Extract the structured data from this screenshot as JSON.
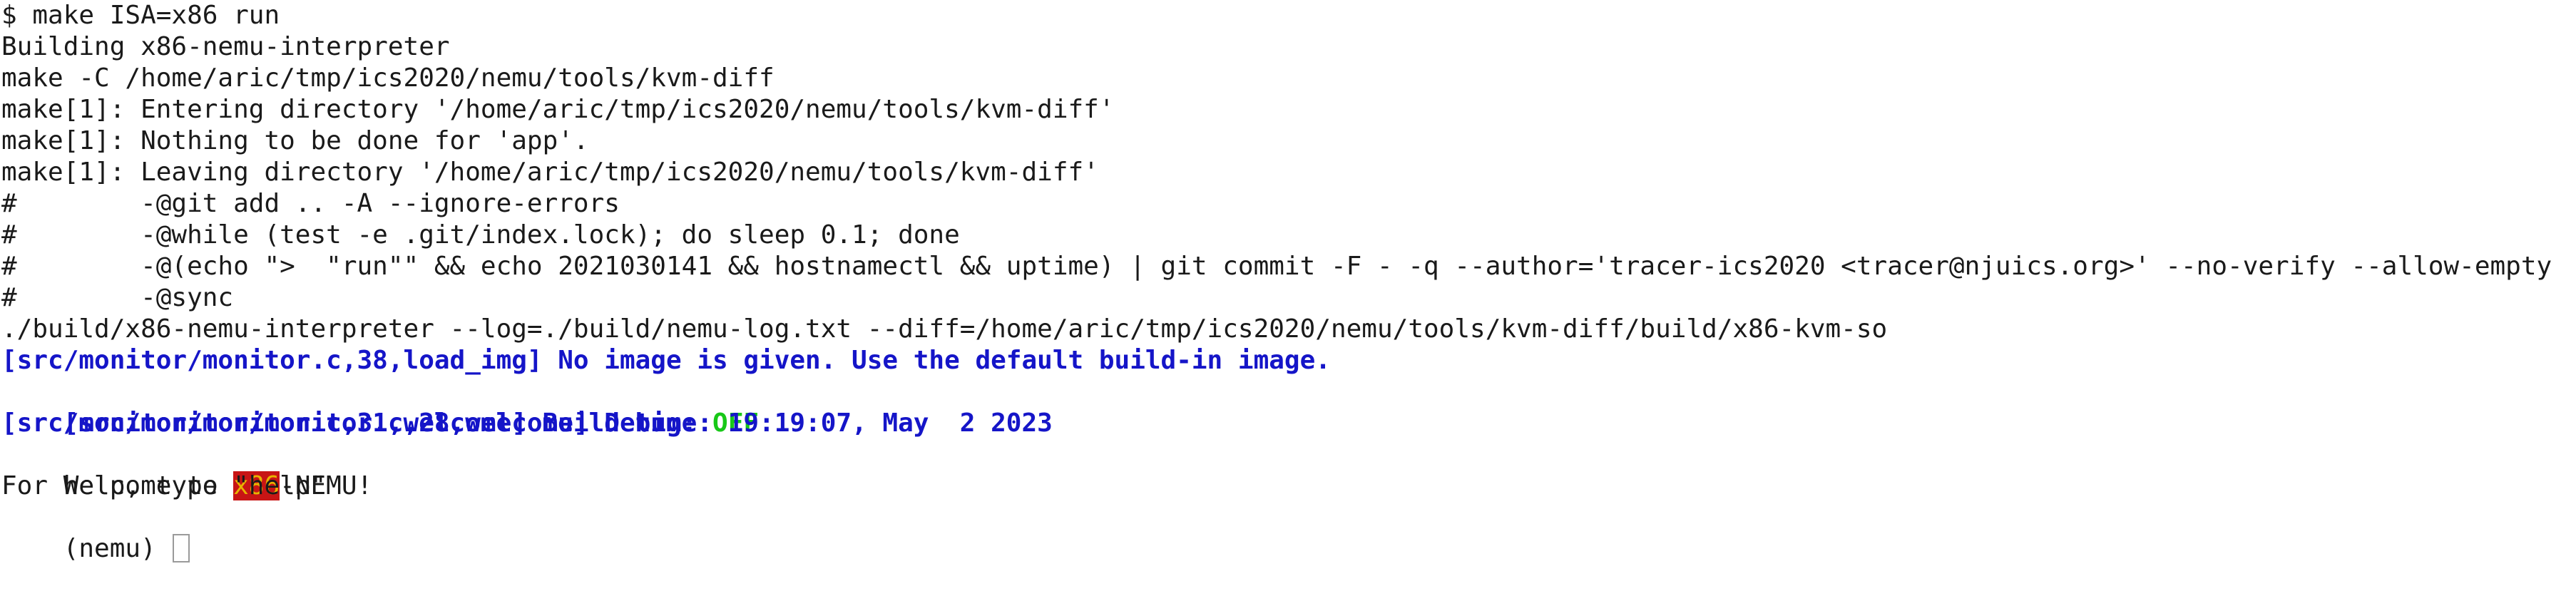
{
  "terminal": {
    "lines": [
      "$ make ISA=x86 run",
      "Building x86-nemu-interpreter",
      "make -C /home/aric/tmp/ics2020/nemu/tools/kvm-diff",
      "make[1]: Entering directory '/home/aric/tmp/ics2020/nemu/tools/kvm-diff'",
      "make[1]: Nothing to be done for 'app'.",
      "make[1]: Leaving directory '/home/aric/tmp/ics2020/nemu/tools/kvm-diff'",
      "#        -@git add .. -A --ignore-errors",
      "#        -@while (test -e .git/index.lock); do sleep 0.1; done",
      "#        -@(echo \">  \"run\"\" && echo 2021030141 && hostnamectl && uptime) | git commit -F - -q --author='tracer-ics2020 <tracer@njuics.org>' --no-verify --allow-empty",
      "#        -@sync",
      "./build/x86-nemu-interpreter --log=./build/nemu-log.txt --diff=/home/aric/tmp/ics2020/nemu/tools/kvm-diff/build/x86-kvm-so"
    ],
    "log_load_img": "[src/monitor/monitor.c,38,load_img] No image is given. Use the default build-in image.",
    "log_debug_prefix": "[src/monitor/monitor.c,28,welcome] Debug: ",
    "log_debug_value": "OFF",
    "log_build_time": "[src/monitor/monitor.c,31,welcome] Build time: 19:19:07, May  2 2023",
    "welcome_prefix": "Welcome to ",
    "welcome_isa": "x86",
    "welcome_suffix": "-NEMU!",
    "help_line": "For help, type \"help\"",
    "prompt": "(nemu) ",
    "colors": {
      "log_blue": "#1515c8",
      "debug_green": "#18c818",
      "isa_background": "#c81515",
      "isa_text": "#e8b400"
    }
  }
}
